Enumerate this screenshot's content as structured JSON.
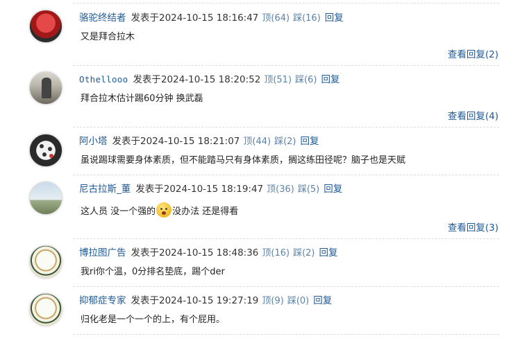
{
  "comments": [
    {
      "username": "骆驼终结者",
      "posted_prefix": "发表于",
      "time": "2024-10-15 18:16:47",
      "up": "顶(64)",
      "down": "踩(16)",
      "reply": "回复",
      "text": "又是拜合拉木",
      "more": "查看回复(2)",
      "avatar": "red-jersey-player-avatar"
    },
    {
      "username": "Othellooo",
      "posted_prefix": "发表于",
      "time": "2024-10-15 18:20:52",
      "up": "顶(51)",
      "down": "踩(6)",
      "reply": "回复",
      "text": "拜合拉木估计踢60分钟 换武磊",
      "more": "查看回复(4)",
      "avatar": "street-photo-avatar"
    },
    {
      "username": "阿小塔",
      "posted_prefix": "发表于",
      "time": "2024-10-15 18:21:07",
      "up": "顶(44)",
      "down": "踩(2)",
      "reply": "回复",
      "text": "虽说踢球需要身体素质，但不能踏马只有身体素质，搁这练田径呢？脑子也是天赋",
      "avatar": "dotted-ball-avatar"
    },
    {
      "username": "尼古拉斯_董",
      "posted_prefix": "发表于",
      "time": "2024-10-15 18:19:47",
      "up": "顶(36)",
      "down": "踩(5)",
      "reply": "回复",
      "text_before": "这人员 没一个强的",
      "text_after": "没办法 还是得看",
      "more": "查看回复(3)",
      "avatar": "landscape-avatar",
      "emoji": "surprised-face-icon"
    },
    {
      "username": "博拉图广告",
      "posted_prefix": "发表于",
      "time": "2024-10-15 18:48:36",
      "up": "顶(16)",
      "down": "踩(2)",
      "reply": "回复",
      "text": "我ri你个温，0分排名垫底，踢个der",
      "avatar": "football-avatar"
    },
    {
      "username": "抑郁症专家",
      "posted_prefix": "发表于",
      "time": "2024-10-15 19:27:19",
      "up": "顶(9)",
      "down": "踩(0)",
      "reply": "回复",
      "text": "归化老是一个一个的上，有个屁用。",
      "avatar": "football-avatar"
    }
  ]
}
